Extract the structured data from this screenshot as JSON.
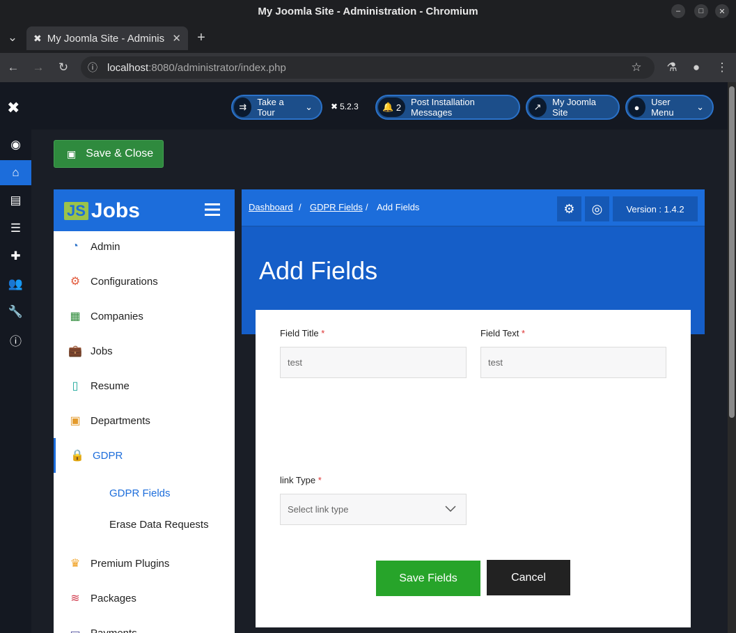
{
  "window": {
    "title": "My Joomla Site - Administration - Chromium"
  },
  "browser": {
    "tab_title": "My Joomla Site - Adminis",
    "url_host": "localhost",
    "url_rest": ":8080/administrator/index.php"
  },
  "header": {
    "take_tour": "Take a Tour",
    "version": "5.2.3",
    "messages_count": "2",
    "messages_label": "Post Installation Messages",
    "site_label": "My Joomla Site",
    "user_menu": "User Menu"
  },
  "toolbar": {
    "save_close": "Save & Close"
  },
  "sidebar": {
    "logo_text": "Jobs",
    "logo_mark": "JS",
    "items": [
      {
        "label": "Admin",
        "icon": "dashboard-icon",
        "color": "#2b72c9"
      },
      {
        "label": "Configurations",
        "icon": "gear-icon",
        "color": "#e2593b"
      },
      {
        "label": "Companies",
        "icon": "building-icon",
        "color": "#2e8b3a"
      },
      {
        "label": "Jobs",
        "icon": "briefcase-icon",
        "color": "#8a4fbf"
      },
      {
        "label": "Resume",
        "icon": "resume-icon",
        "color": "#1aa79a"
      },
      {
        "label": "Departments",
        "icon": "id-badge-icon",
        "color": "#e39a2b"
      },
      {
        "label": "GDPR",
        "icon": "lock-icon",
        "color": "#e9b400"
      }
    ],
    "gdpr_sub": [
      "GDPR Fields",
      "Erase Data Requests"
    ],
    "more_items": [
      {
        "label": "Premium Plugins",
        "icon": "crown-icon",
        "color": "#f0a020"
      },
      {
        "label": "Packages",
        "icon": "database-icon",
        "color": "#d0384a"
      },
      {
        "label": "Payments",
        "icon": "payment-icon",
        "color": "#4a4a9a"
      }
    ]
  },
  "breadcrumb": {
    "home": "Dashboard",
    "section": "GDPR Fields",
    "current": "Add Fields"
  },
  "version_label": "Version : 1.4.2",
  "page_title": "Add Fields",
  "form": {
    "field_title_label": "Field Title",
    "field_title_value": "test",
    "field_text_label": "Field Text",
    "field_text_value": "test",
    "link_type_label": "link Type",
    "link_type_value": "Select link type",
    "required_marker": "*",
    "save_button": "Save Fields",
    "cancel_button": "Cancel"
  }
}
